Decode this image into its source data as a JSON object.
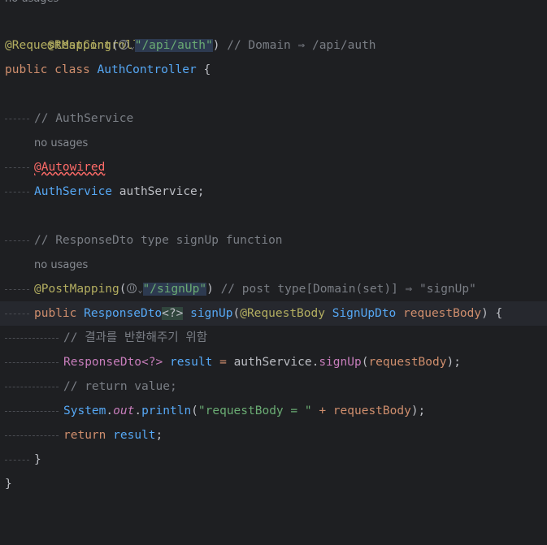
{
  "top_hint": "no usages",
  "l1": {
    "annotation": "@RestController"
  },
  "l2": {
    "annotation": "@RequestMapping",
    "open": "(",
    "path": "\"/api/auth\"",
    "close": ")",
    "comment": " // Domain ⇒ /api/auth"
  },
  "l3": {
    "kw_public": "public",
    "kw_class": "class",
    "class_name": "AuthController",
    "brace": " {"
  },
  "l5": {
    "comment": "// AuthService"
  },
  "l6": {
    "hint": "no usages"
  },
  "l7": {
    "annotation": "@Autowired"
  },
  "l8": {
    "type": "AuthService",
    "field": " authService;"
  },
  "l10": {
    "comment": "// ResponseDto type signUp function"
  },
  "l11": {
    "hint": "no usages"
  },
  "l12": {
    "annotation": "@PostMapping",
    "open": "(",
    "path": "\"/signUp\"",
    "close": ")",
    "comment": " // post type[Domain(set)] ⇒ \"signUp\""
  },
  "l13": {
    "kw_public": "public",
    "return_type": "ResponseDto",
    "generic": "<?>",
    "method": "signUp",
    "open": "(",
    "param_ann": "@RequestBody",
    "param_type": "SignUpDto",
    "param_name": "requestBody",
    "close": ") {"
  },
  "l14": {
    "comment": "// 결과를 반환해주기 위함"
  },
  "l15": {
    "type": "ResponseDto",
    "generic": "<?>",
    "var": "result",
    "eq": " = ",
    "obj": "authService",
    "dot": ".",
    "method": "signUp",
    "open": "(",
    "arg": "requestBody",
    "close": ");"
  },
  "l16": {
    "comment": "// return value;"
  },
  "l17": {
    "cls": "System",
    "dot1": ".",
    "field": "out",
    "dot2": ".",
    "method": "println",
    "open": "(",
    "str": "\"requestBody = \"",
    "plus": " + ",
    "arg": "requestBody",
    "close": ");"
  },
  "l18": {
    "kw": "return",
    "var": "result",
    "semi": ";"
  },
  "l19": {
    "brace": "}"
  },
  "l20": {
    "brace": "}"
  },
  "icons": {
    "inlay": "globe-icon",
    "inlay_chevron": "chevron-down-icon"
  },
  "colors": {
    "background": "#1e1f22",
    "keyword": "#cf8e6d",
    "annotation": "#b3ae60",
    "string": "#6aab73",
    "comment": "#7a7e85",
    "method": "#56a8f5",
    "field": "#c77dbb"
  }
}
